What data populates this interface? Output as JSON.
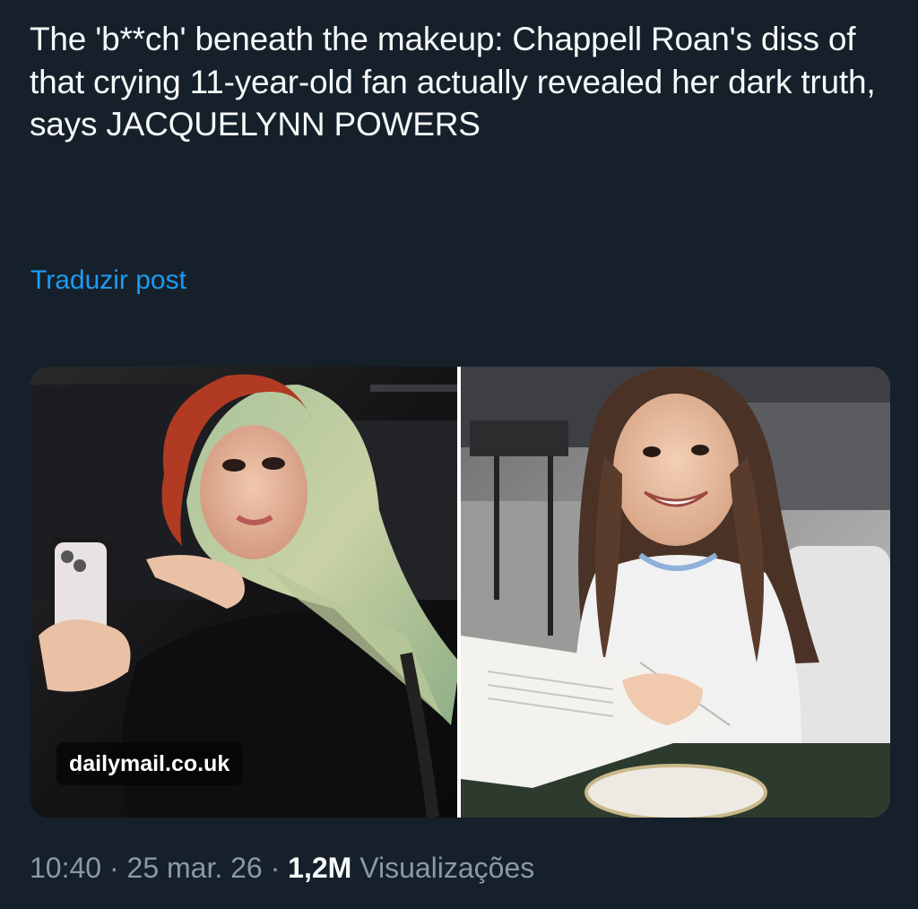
{
  "post": {
    "text": "The 'b**ch' beneath the makeup: Chappell Roan's diss of that crying 11-year-old fan actually revealed her dark truth, says JACQUELYNN POWERS",
    "translate_label": "Traduzir post"
  },
  "media": {
    "source_label": "dailymail.co.uk",
    "left_photo_icon": "woman-with-red-hair-and-headscarf-holding-phone-photo",
    "right_photo_icon": "smiling-girl-reading-at-restaurant-table-photo"
  },
  "meta": {
    "time": "10:40",
    "separator1": " · ",
    "date": "25 mar. 26",
    "separator2": " · ",
    "views_count": "1,2M",
    "views_label": " Visualizações"
  },
  "colors": {
    "background": "#15202b",
    "text": "#f7f9f9",
    "link": "#1d9bf0",
    "muted": "#8b98a5"
  }
}
